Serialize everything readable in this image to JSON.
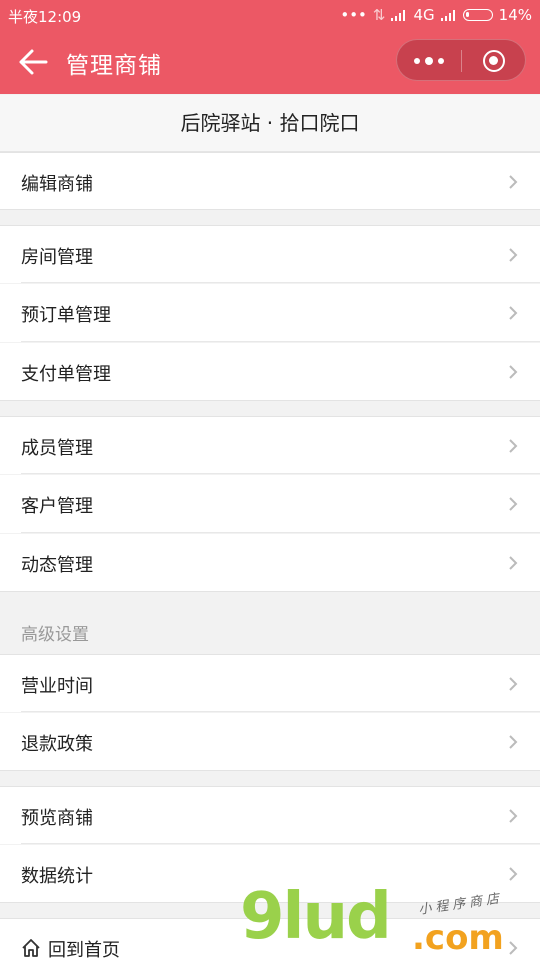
{
  "status_bar": {
    "time": "半夜12:09",
    "network": "4G",
    "battery": "14%"
  },
  "nav": {
    "title": "管理商铺"
  },
  "shop_name": "后院驿站 · 拾口院口",
  "groups": {
    "edit": "编辑商铺",
    "room": "房间管理",
    "booking": "预订单管理",
    "payment": "支付单管理",
    "member": "成员管理",
    "customer": "客户管理",
    "news": "动态管理",
    "advanced_title": "高级设置",
    "hours": "营业时间",
    "refund": "退款政策",
    "preview": "预览商铺",
    "stats": "数据统计",
    "home": "回到首页"
  },
  "watermark": {
    "brand": "9lud",
    "domain": ".com",
    "tagline": "小程序商店"
  },
  "colors": {
    "accent": "#ec5865",
    "background": "#f2f2f2"
  }
}
